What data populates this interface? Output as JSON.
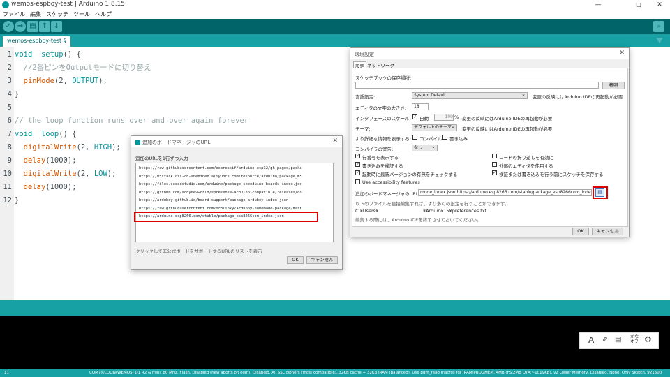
{
  "window": {
    "title": "wemos-espboy-test | Arduino 1.8.15",
    "minimize": "—",
    "maximize": "□",
    "close": "✕"
  },
  "menu": [
    "ファイル",
    "編集",
    "スケッチ",
    "ツール",
    "ヘルプ"
  ],
  "toolbar": {
    "verify": "✓",
    "upload": "→",
    "new": "▤",
    "open": "↑",
    "save": "↓",
    "serial": "⌕"
  },
  "tab": {
    "label": "wemos-espboy-test §"
  },
  "code": [
    {
      "n": "1",
      "parts": [
        [
          "kw",
          "void"
        ],
        [
          "",
          "  "
        ],
        [
          "kw",
          "setup"
        ],
        [
          "",
          "() {"
        ]
      ]
    },
    {
      "n": "2",
      "parts": [
        [
          "ct",
          "  //2番ピンをOutputモードに切り替え"
        ]
      ]
    },
    {
      "n": "3",
      "parts": [
        [
          "",
          "  "
        ],
        [
          "fn",
          "pinMode"
        ],
        [
          "",
          "(2, "
        ],
        [
          "kw",
          "OUTPUT"
        ],
        [
          "",
          ");"
        ]
      ]
    },
    {
      "n": "4",
      "parts": [
        [
          "",
          "}"
        ]
      ]
    },
    {
      "n": "5",
      "parts": [
        [
          "",
          ""
        ]
      ]
    },
    {
      "n": "6",
      "parts": [
        [
          "ct",
          "// the loop function runs over and over again forever"
        ]
      ]
    },
    {
      "n": "7",
      "parts": [
        [
          "kw",
          "void"
        ],
        [
          "",
          "  "
        ],
        [
          "kw",
          "loop"
        ],
        [
          "",
          "() {"
        ]
      ]
    },
    {
      "n": "8",
      "parts": [
        [
          "",
          "  "
        ],
        [
          "fn",
          "digitalWrite"
        ],
        [
          "",
          "(2, "
        ],
        [
          "kw",
          "HIGH"
        ],
        [
          "",
          ");"
        ]
      ]
    },
    {
      "n": "9",
      "parts": [
        [
          "",
          "  "
        ],
        [
          "fn",
          "delay"
        ],
        [
          "",
          "(1000);"
        ]
      ]
    },
    {
      "n": "10",
      "parts": [
        [
          "",
          "  "
        ],
        [
          "fn",
          "digitalWrite"
        ],
        [
          "",
          "(2, "
        ],
        [
          "kw",
          "LOW"
        ],
        [
          "",
          ");"
        ]
      ]
    },
    {
      "n": "11",
      "parts": [
        [
          "",
          "  "
        ],
        [
          "fn",
          "delay"
        ],
        [
          "",
          "(1000);"
        ]
      ]
    },
    {
      "n": "12",
      "parts": [
        [
          "",
          "}"
        ]
      ]
    }
  ],
  "prefs": {
    "title": "環境設定",
    "tabs": [
      "設定",
      "ネットワーク"
    ],
    "sketchbook_label": "スケッチブックの保存場所:",
    "browse": "参照",
    "lang_label": "言語設定:",
    "lang_value": "System Default",
    "restart_note": "変更の反映にはArduino IDEの再起動が必要",
    "fontsize_label": "エディタの文字の大きさ:",
    "fontsize_value": "18",
    "scale_label": "インタフェースのスケール:",
    "scale_auto": "自動",
    "scale_value": "100",
    "scale_pct": "%",
    "theme_label": "テーマ:",
    "theme_value": "デフォルトのテーマ",
    "verbose_label": "より詳細な情報を表示する:",
    "verbose_compile": "コンパイル",
    "verbose_upload": "書き込み",
    "warnings_label": "コンパイラの警告:",
    "warnings_value": "なし",
    "checks": [
      {
        "label": "行番号を表示する",
        "checked": true
      },
      {
        "label": "コードの折り返しを有効に",
        "checked": false
      },
      {
        "label": "書き込みを検証する",
        "checked": true
      },
      {
        "label": "外部のエディタを使用する",
        "checked": false
      },
      {
        "label": "起動時に最新バージョンの有無をチェックする",
        "checked": true
      },
      {
        "label": "検証または書き込みを行う前にスケッチを保存する",
        "checked": true
      },
      {
        "label": "Use accessibility features",
        "checked": false
      }
    ],
    "boards_url_label": "追加のボードマネージャのURL:",
    "boards_url_value": "mode_index.json,https://arduino.esp8266.com/stable/package_esp8266com_index.json",
    "direct_edit_note": "以下のファイルを直接編集すれば、より多くの設定を行うことができます。",
    "pref_path_left": "C:¥Users¥",
    "pref_path_right": "¥Arduino15¥preferences.txt",
    "edit_warning": "編集する際には、Arduino IDEを終了させておいてください。",
    "ok": "OK",
    "cancel": "キャンセル",
    "close": "✕"
  },
  "boards_dialog": {
    "title": "追加のボードマネージャのURL",
    "instruction": "追加のURLを1行ずつ入力",
    "urls": [
      "https://raw.githubusercontent.com/espressif/arduino-esp32/gh-pages/packa",
      "https://m5stack.oss-cn-shenzhen.aliyuncs.com/resource/arduino/package_m5",
      "https://files.seeedstudio.com/arduino/package_seeeduino_boards_index.jso",
      "https://github.com/sonydevworld/spresense-arduino-compatible/releases/do",
      "https://arduboy.github.io/board-support/package_arduboy_index.json",
      "https://raw.githubusercontent.com/MrBlinky/Arduboy-homemade-package/mast",
      "https://arduino.esp8266.com/stable/package_esp8266com_index.json"
    ],
    "hint": "クリックして非公式ボードをサポートするURLのリストを表示",
    "ok": "OK",
    "cancel": "キャンセル",
    "close": "✕"
  },
  "ime": {
    "a": "A",
    "kana": "かな",
    "kana2": "オフ"
  },
  "status": {
    "line": "11",
    "board": "COM7のLOLIN(WEMOS) D1 R2 & mini, 80 MHz, Flash, Disabled (new aborts on oom), Disabled, All SSL ciphers (most compatible), 32KB cache + 32KB IRAM (balanced), Use pgm_read macros for IRAM/PROGMEM, 4MB (FS:2MB OTA:~1019KB), v2 Lower Memory, Disabled, None, Only Sketch, 921600"
  },
  "colors": {
    "toolbar": "#006468",
    "accent": "#17a1a5",
    "highlight": "#e00000"
  }
}
